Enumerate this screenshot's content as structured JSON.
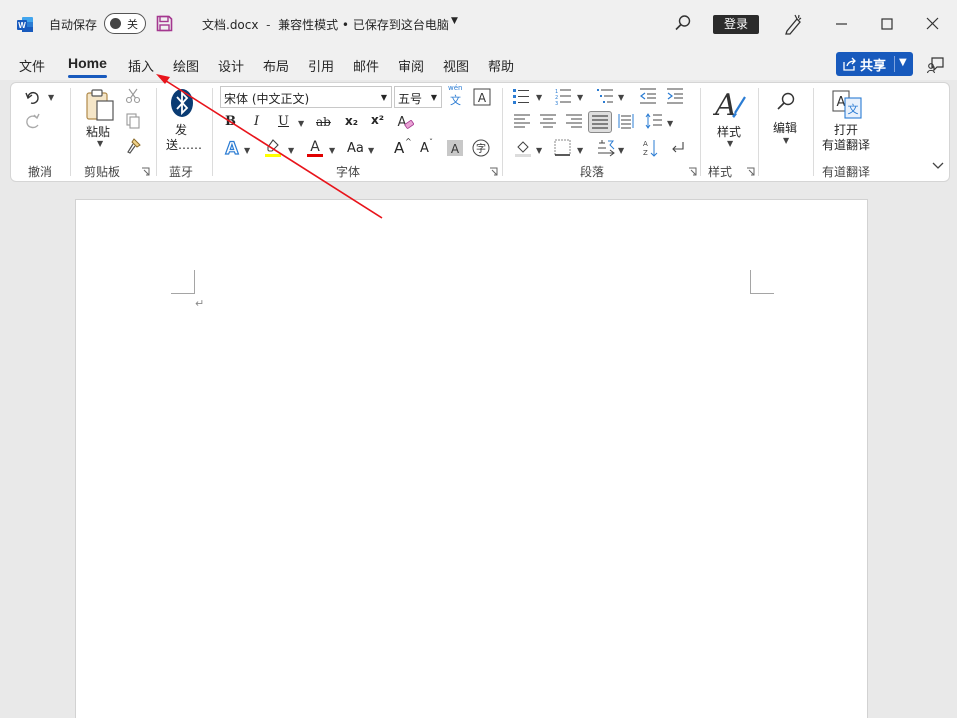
{
  "titlebar": {
    "autosave_label": "自动保存",
    "autosave_state": "关",
    "doc_name": "文档.docx",
    "separator": "-",
    "doc_status": "兼容性模式 • 已保存到这台电脑",
    "login_label": "登录"
  },
  "tabs": {
    "items": [
      {
        "label": "文件"
      },
      {
        "label": "Home"
      },
      {
        "label": "插入"
      },
      {
        "label": "绘图"
      },
      {
        "label": "设计"
      },
      {
        "label": "布局"
      },
      {
        "label": "引用"
      },
      {
        "label": "邮件"
      },
      {
        "label": "审阅"
      },
      {
        "label": "视图"
      },
      {
        "label": "帮助"
      }
    ],
    "active": "Home",
    "share_label": "共享"
  },
  "ribbon": {
    "undo_group": "撤消",
    "clipboard": {
      "paste_label": "粘贴",
      "group_label": "剪贴板"
    },
    "bluetooth": {
      "send_label_line1": "发",
      "send_label_line2": "送……",
      "group_label": "蓝牙"
    },
    "font": {
      "font_name": "宋体 (中文正文)",
      "font_size": "五号",
      "phonetic_top": "wén",
      "phonetic_char": "文",
      "bold": "B",
      "italic": "I",
      "underline": "U",
      "strike": "ab",
      "subscript": "x₂",
      "superscript": "x²",
      "change_case": "Aa",
      "grow": "A",
      "shrink": "A",
      "enclose": "字",
      "group_label": "字体"
    },
    "paragraph": {
      "group_label": "段落"
    },
    "styles": {
      "label": "样式",
      "group_label": "样式"
    },
    "editing": {
      "label": "编辑"
    },
    "youdao": {
      "label_line1": "打开",
      "label_line2": "有道翻译",
      "group_label": "有道翻译"
    }
  },
  "colors": {
    "accent": "#185abd",
    "word_brand": "#185abd",
    "save_icon": "#a4378f",
    "highlight": "#ffff00",
    "font_color": "#e00000",
    "annotation_arrow": "#e8141b"
  },
  "document": {
    "paragraph_mark": "↵"
  }
}
